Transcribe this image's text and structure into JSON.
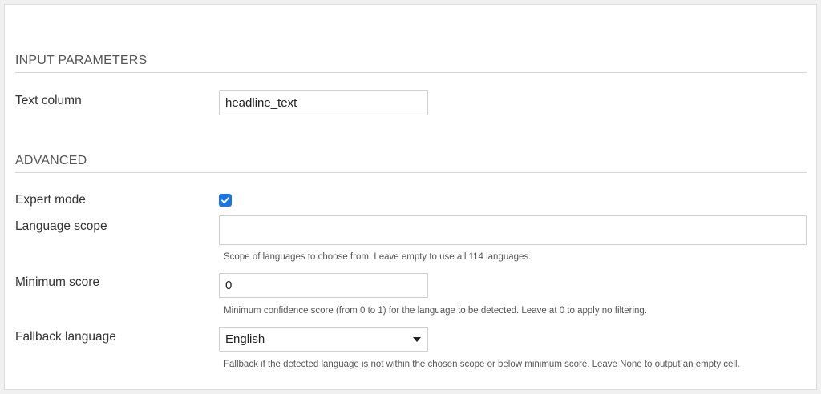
{
  "sections": {
    "input_parameters": {
      "title": "INPUT PARAMETERS"
    },
    "advanced": {
      "title": "ADVANCED"
    }
  },
  "fields": {
    "text_column": {
      "label": "Text column",
      "value": "headline_text"
    },
    "expert_mode": {
      "label": "Expert mode",
      "checked": true
    },
    "language_scope": {
      "label": "Language scope",
      "value": "",
      "help": "Scope of languages to choose from. Leave empty to use all 114 languages."
    },
    "minimum_score": {
      "label": "Minimum score",
      "value": "0",
      "help": "Minimum confidence score (from 0 to 1) for the language to be detected. Leave at 0 to apply no filtering."
    },
    "fallback_language": {
      "label": "Fallback language",
      "value": "English",
      "help": "Fallback if the detected language is not within the chosen scope or below minimum score. Leave None to output an empty cell."
    }
  },
  "colors": {
    "accent": "#1a73e8"
  },
  "icons": {
    "checkbox": "checkmark-icon",
    "dropdown": "caret-down-icon"
  }
}
